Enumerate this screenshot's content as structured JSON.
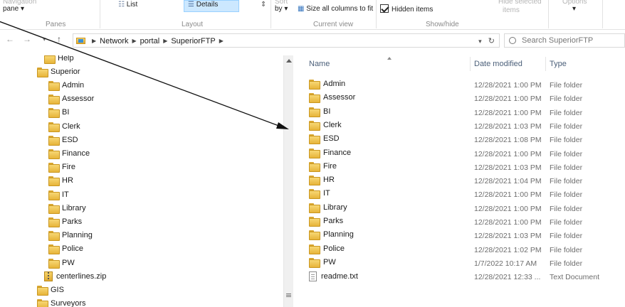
{
  "ribbon": {
    "nav_pane_top": "Navigation",
    "nav_pane_label": "pane",
    "list_label": "List",
    "details_label": "Details",
    "sort_label": "by",
    "size_columns_label": "Size all columns to fit",
    "hidden_items_label": "Hidden items",
    "hide_selected_label": "items",
    "groups": {
      "panes": "Panes",
      "layout": "Layout",
      "current_view": "Current view",
      "show_hide": "Show/hide"
    }
  },
  "address": {
    "crumbs": [
      "Network",
      "portal",
      "SuperiorFTP"
    ],
    "search_placeholder": "Search SuperiorFTP"
  },
  "nav_tree": [
    {
      "label": "Help",
      "kind": "folder"
    },
    {
      "label": "Superior",
      "kind": "folder"
    },
    {
      "label": "Admin",
      "kind": "folder"
    },
    {
      "label": "Assessor",
      "kind": "folder"
    },
    {
      "label": "BI",
      "kind": "folder"
    },
    {
      "label": "Clerk",
      "kind": "folder"
    },
    {
      "label": "ESD",
      "kind": "folder"
    },
    {
      "label": "Finance",
      "kind": "folder"
    },
    {
      "label": "Fire",
      "kind": "folder"
    },
    {
      "label": "HR",
      "kind": "folder"
    },
    {
      "label": "IT",
      "kind": "folder"
    },
    {
      "label": "Library",
      "kind": "folder"
    },
    {
      "label": "Parks",
      "kind": "folder"
    },
    {
      "label": "Planning",
      "kind": "folder"
    },
    {
      "label": "Police",
      "kind": "folder"
    },
    {
      "label": "PW",
      "kind": "folder"
    },
    {
      "label": "centerlines.zip",
      "kind": "zip"
    },
    {
      "label": "GIS",
      "kind": "folder"
    },
    {
      "label": "Surveyors",
      "kind": "folder"
    }
  ],
  "columns": {
    "name": "Name",
    "date": "Date modified",
    "type": "Type"
  },
  "files": [
    {
      "name": "Admin",
      "date": "12/28/2021 1:00 PM",
      "type": "File folder",
      "kind": "folder"
    },
    {
      "name": "Assessor",
      "date": "12/28/2021 1:00 PM",
      "type": "File folder",
      "kind": "folder"
    },
    {
      "name": "BI",
      "date": "12/28/2021 1:00 PM",
      "type": "File folder",
      "kind": "folder"
    },
    {
      "name": "Clerk",
      "date": "12/28/2021 1:03 PM",
      "type": "File folder",
      "kind": "folder"
    },
    {
      "name": "ESD",
      "date": "12/28/2021 1:08 PM",
      "type": "File folder",
      "kind": "folder"
    },
    {
      "name": "Finance",
      "date": "12/28/2021 1:00 PM",
      "type": "File folder",
      "kind": "folder"
    },
    {
      "name": "Fire",
      "date": "12/28/2021 1:03 PM",
      "type": "File folder",
      "kind": "folder"
    },
    {
      "name": "HR",
      "date": "12/28/2021 1:04 PM",
      "type": "File folder",
      "kind": "folder"
    },
    {
      "name": "IT",
      "date": "12/28/2021 1:00 PM",
      "type": "File folder",
      "kind": "folder"
    },
    {
      "name": "Library",
      "date": "12/28/2021 1:00 PM",
      "type": "File folder",
      "kind": "folder"
    },
    {
      "name": "Parks",
      "date": "12/28/2021 1:00 PM",
      "type": "File folder",
      "kind": "folder"
    },
    {
      "name": "Planning",
      "date": "12/28/2021 1:03 PM",
      "type": "File folder",
      "kind": "folder"
    },
    {
      "name": "Police",
      "date": "12/28/2021 1:02 PM",
      "type": "File folder",
      "kind": "folder"
    },
    {
      "name": "PW",
      "date": "1/7/2022 10:17 AM",
      "type": "File folder",
      "kind": "folder"
    },
    {
      "name": "readme.txt",
      "date": "12/28/2021 12:33 ...",
      "type": "Text Document",
      "kind": "text"
    }
  ]
}
